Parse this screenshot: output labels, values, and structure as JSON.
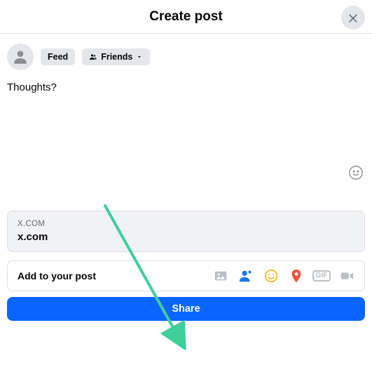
{
  "header": {
    "title": "Create post"
  },
  "userbar": {
    "feed_chip": "Feed",
    "audience_chip": "Friends"
  },
  "composer": {
    "placeholder": "Thoughts?"
  },
  "link_preview": {
    "host": "X.COM",
    "title": "x.com"
  },
  "add_to_post": {
    "label": "Add to your post",
    "icons": {
      "photo": "photo-icon",
      "tag": "tag-people-icon",
      "feeling": "feeling-icon",
      "checkin": "check-in-icon",
      "gif": "GIF",
      "live": "live-video-icon"
    }
  },
  "actions": {
    "share": "Share"
  },
  "colors": {
    "primary": "#0866ff",
    "arrow": "#3ecf9a"
  }
}
